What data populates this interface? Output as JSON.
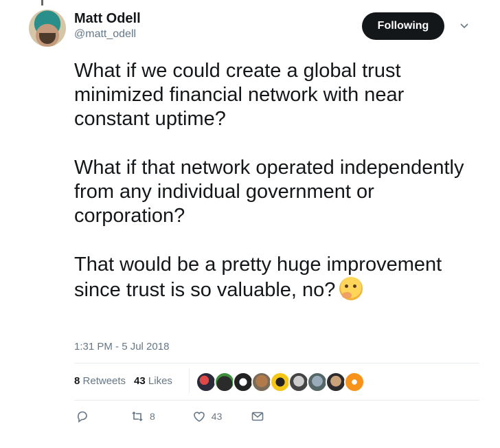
{
  "author": {
    "name": "Matt Odell",
    "handle": "@matt_odell"
  },
  "follow_button": {
    "label": "Following"
  },
  "tweet": {
    "paragraphs": [
      "What if we could create a global trust minimized financial network with near constant uptime?",
      "What if that network operated independently from any individual government or corporation?",
      "That would be a pretty huge improvement since trust is so valuable, no?"
    ],
    "emoji": "thinking-face-emoji"
  },
  "timestamp": "1:31 PM - 5 Jul 2018",
  "stats": {
    "retweets_count": "8",
    "retweets_label": "Retweets",
    "likes_count": "43",
    "likes_label": "Likes"
  },
  "actions": {
    "retweet_count": "8",
    "like_count": "43"
  },
  "colors": {
    "text": "#14171a",
    "secondary": "#657786",
    "divider": "#e6ecf0",
    "button": "#14171a"
  },
  "icons": [
    "chevron-down-icon",
    "reply-icon",
    "retweet-icon",
    "like-icon",
    "dm-icon"
  ]
}
